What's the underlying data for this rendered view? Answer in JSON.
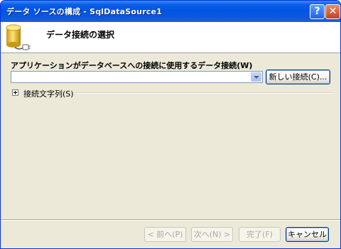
{
  "window": {
    "title": "データ ソースの構成 - SqlDataSource1",
    "help_glyph": "?",
    "close_glyph": "✕"
  },
  "header": {
    "icon": "database-plug-icon",
    "title": "データ接続の選択"
  },
  "connection": {
    "label": "アプリケーションがデータベースへの接続に使用するデータ接続(W)",
    "selected_value": "",
    "new_connection_button": "新しい接続(C)..."
  },
  "connection_string": {
    "label": "接続文字列(S)",
    "expanded": false
  },
  "footer": {
    "back": "< 前へ(P)",
    "next": "次へ(N) >",
    "finish": "完了(F)",
    "cancel": "キャンセル"
  },
  "colors": {
    "titlebar": "#0054e3",
    "dialog_bg": "#ece9d8",
    "header_bg": "#ffffff"
  }
}
